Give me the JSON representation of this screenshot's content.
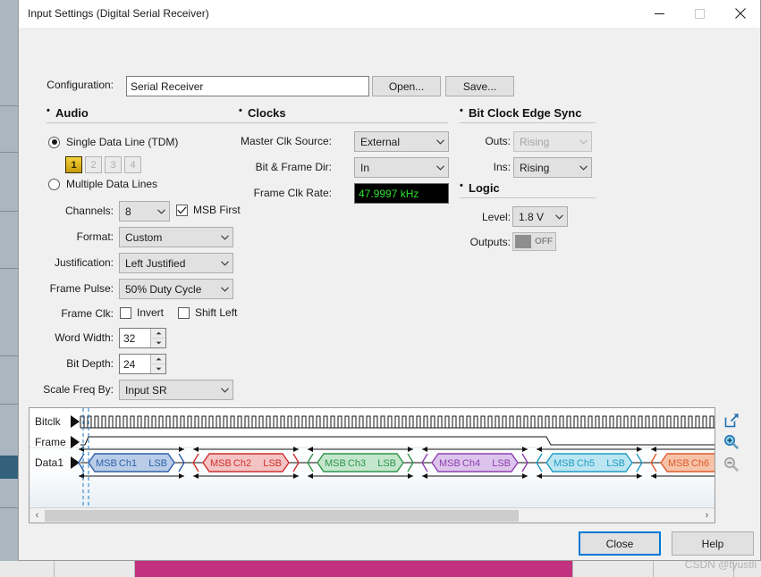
{
  "window": {
    "title": "Input Settings (Digital Serial Receiver)",
    "minimize_icon": "minimize-icon",
    "maximize_icon": "maximize-icon",
    "close_icon": "close-icon"
  },
  "config": {
    "label": "Configuration:",
    "value": "Serial Receiver",
    "placeholder": "Configuration name",
    "open_label": "Open...",
    "save_label": "Save..."
  },
  "audio": {
    "title": "Audio",
    "single_data_line": "Single Data Line (TDM)",
    "multiple_data_lines": "Multiple Data Lines",
    "line_buttons": [
      "1",
      "2",
      "3",
      "4"
    ],
    "selected_line": "1",
    "channels_label": "Channels:",
    "channels_value": "8",
    "msb_first_label": "MSB First",
    "msb_first_checked": true,
    "format_label": "Format:",
    "format_value": "Custom",
    "justification_label": "Justification:",
    "justification_value": "Left Justified",
    "frame_pulse_label": "Frame Pulse:",
    "frame_pulse_value": "50% Duty Cycle",
    "frame_clk_label": "Frame Clk:",
    "invert_label": "Invert",
    "invert_checked": false,
    "shift_left_label": "Shift Left",
    "shift_left_checked": false,
    "word_width_label": "Word Width:",
    "word_width_value": "32",
    "bit_depth_label": "Bit Depth:",
    "bit_depth_value": "24",
    "scale_freq_label": "Scale Freq By:",
    "scale_freq_value": "Input SR"
  },
  "clocks": {
    "title": "Clocks",
    "master_clk_label": "Master Clk Source:",
    "master_clk_value": "External",
    "bit_frame_dir_label": "Bit & Frame Dir:",
    "bit_frame_dir_value": "In",
    "frame_clk_rate_label": "Frame Clk Rate:",
    "frame_clk_rate_value": "47.9997 kHz",
    "frame_clk_rate_color": "#2ee02e"
  },
  "bit_clock_edge_sync": {
    "title": "Bit Clock Edge Sync",
    "outs_label": "Outs:",
    "outs_value": "Rising",
    "outs_disabled": true,
    "ins_label": "Ins:",
    "ins_value": "Rising"
  },
  "logic": {
    "title": "Logic",
    "level_label": "Level:",
    "level_value": "1.8 V",
    "outputs_label": "Outputs:",
    "outputs_toggle_state": "OFF"
  },
  "waveform": {
    "signals": [
      "Bitclk",
      "Frame",
      "Data1"
    ],
    "channels": [
      {
        "name": "Ch1",
        "msb": "MSB",
        "lsb": "LSB",
        "color": "#2f5fa8",
        "fill": "#b9cde8"
      },
      {
        "name": "Ch2",
        "msb": "MSB",
        "lsb": "LSB",
        "color": "#cf2f2f",
        "fill": "#f4c4c4"
      },
      {
        "name": "Ch3",
        "msb": "MSB",
        "lsb": "LSB",
        "color": "#2f9648",
        "fill": "#c3e6cd"
      },
      {
        "name": "Ch4",
        "msb": "MSB",
        "lsb": "LSB",
        "color": "#8e3fb0",
        "fill": "#ddc4ec"
      },
      {
        "name": "Ch5",
        "msb": "MSB",
        "lsb": "LSB",
        "color": "#1e9cc4",
        "fill": "#bce5f2"
      },
      {
        "name": "Ch6",
        "msb": "MSB",
        "lsb": "LSB",
        "color": "#e05a2b",
        "fill": "#f6c3a9"
      }
    ],
    "popout_icon": "popout-icon",
    "zoom_in_icon": "zoom-in-icon",
    "zoom_out_icon": "zoom-out-icon",
    "zoom_out_disabled": true,
    "scroll_left_icon": "chevron-left-icon",
    "scroll_right_icon": "chevron-right-icon"
  },
  "footer": {
    "close_label": "Close",
    "help_label": "Help",
    "watermark": "CSDN @tyustli"
  }
}
